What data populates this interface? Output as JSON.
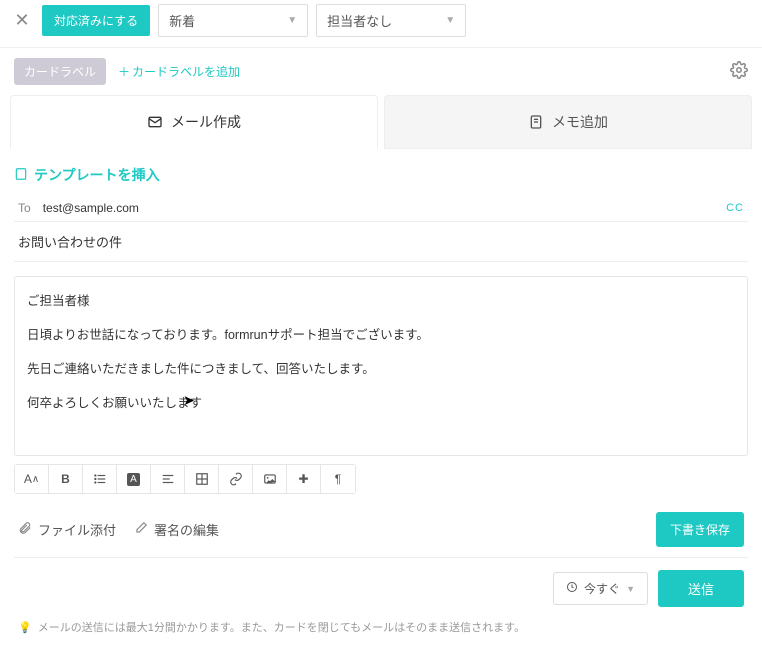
{
  "topbar": {
    "mark_done": "対応済みにする",
    "status": "新着",
    "assignee": "担当者なし"
  },
  "labelbar": {
    "label_pill": "カードラベル",
    "add_label": "カードラベルを追加"
  },
  "tabs": {
    "compose": "メール作成",
    "memo": "メモ追加"
  },
  "compose": {
    "insert_template": "テンプレートを挿入",
    "to_label": "To",
    "to_value": "test@sample.com",
    "cc": "CC",
    "subject": "お問い合わせの件",
    "body_line1": "ご担当者様",
    "body_line2": "日頃よりお世話になっております。formrunサポート担当でございます。",
    "body_line3": "先日ご連絡いただきました件につきまして、回答いたします。",
    "body_line4": "何卒よろしくお願いいたします"
  },
  "actions": {
    "attach_file": "ファイル添付",
    "edit_signature": "署名の編集",
    "save_draft": "下書き保存",
    "schedule": "今すぐ",
    "send": "送信"
  },
  "footnote": "メールの送信には最大1分間かかります。また、カードを閉じてもメールはそのまま送信されます。"
}
